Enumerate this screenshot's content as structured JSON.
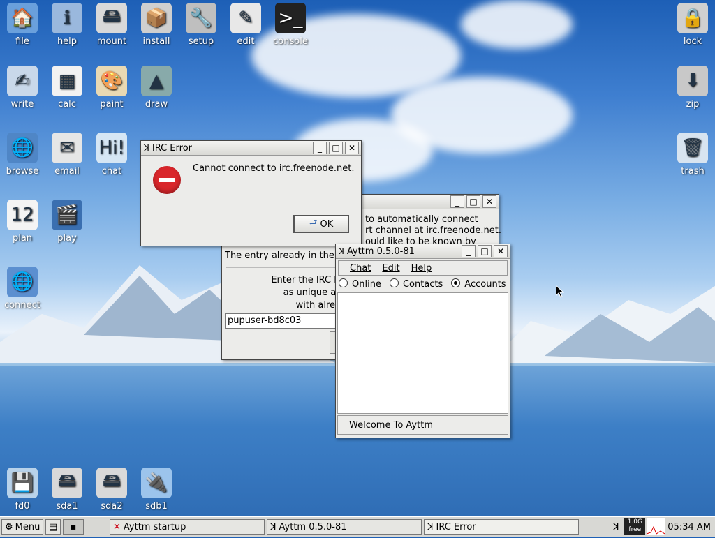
{
  "desktop_icons_left": [
    {
      "name": "file",
      "label": "file",
      "glyph": "🏠",
      "bg": "#6aa0dc"
    },
    {
      "name": "help",
      "label": "help",
      "glyph": "ℹ",
      "bg": "#9ab8dd"
    },
    {
      "name": "mount",
      "label": "mount",
      "glyph": "🖴",
      "bg": "#d9d9d9"
    },
    {
      "name": "install",
      "label": "install",
      "glyph": "📦",
      "bg": "#cfcfcf"
    },
    {
      "name": "setup",
      "label": "setup",
      "glyph": "🔧",
      "bg": "#bfbfbf"
    },
    {
      "name": "edit",
      "label": "edit",
      "glyph": "✎",
      "bg": "#e8e8e8"
    },
    {
      "name": "console",
      "label": "console",
      "glyph": ">_",
      "bg": "#222"
    },
    {
      "name": "write",
      "label": "write",
      "glyph": "✍",
      "bg": "#c9d8ea"
    },
    {
      "name": "calc",
      "label": "calc",
      "glyph": "▦",
      "bg": "#f2f2f2"
    },
    {
      "name": "paint",
      "label": "paint",
      "glyph": "🎨",
      "bg": "#e9d9b3"
    },
    {
      "name": "draw",
      "label": "draw",
      "glyph": "▲",
      "bg": "#8aa"
    },
    {
      "name": "browse",
      "label": "browse",
      "glyph": "🌐",
      "bg": "#4f86c6"
    },
    {
      "name": "email",
      "label": "email",
      "glyph": "✉",
      "bg": "#e6e6e6"
    },
    {
      "name": "chat",
      "label": "chat",
      "glyph": "Hi!",
      "bg": "#d6e6f4"
    },
    {
      "name": "plan",
      "label": "plan",
      "glyph": "12",
      "bg": "#f4f4f4"
    },
    {
      "name": "play",
      "label": "play",
      "glyph": "🎬",
      "bg": "#3a6fb0"
    },
    {
      "name": "connect",
      "label": "connect",
      "glyph": "🌐",
      "bg": "#5b8fd0"
    },
    {
      "name": "fd0",
      "label": "fd0",
      "glyph": "💾",
      "bg": "#b8d2ea"
    },
    {
      "name": "sda1",
      "label": "sda1",
      "glyph": "🖴",
      "bg": "#d9d9d9"
    },
    {
      "name": "sda2",
      "label": "sda2",
      "glyph": "🖴",
      "bg": "#d9d9d9"
    },
    {
      "name": "sdb1",
      "label": "sdb1",
      "glyph": "🔌",
      "bg": "#9cc4ec"
    }
  ],
  "desktop_icons_right": [
    {
      "name": "lock",
      "label": "lock",
      "glyph": "🔒",
      "bg": "#d0d0d0"
    },
    {
      "name": "zip",
      "label": "zip",
      "glyph": "⬇",
      "bg": "#c8c8c8"
    },
    {
      "name": "trash",
      "label": "trash",
      "glyph": "🗑",
      "bg": "#d8e4f0"
    }
  ],
  "irc_error": {
    "title": "IRC Error",
    "message": "Cannot connect to irc.freenode.net.",
    "ok_label": "OK"
  },
  "aytum_startup_partial": {
    "line1": "to automatically connect",
    "line2": "rt channel at irc.freenode.net.",
    "line3": "ould like to be known by",
    "entry_text": "The entry already in the",
    "prompt1": "Enter the IRC N",
    "prompt2": "as unique as",
    "prompt3": "with alrea",
    "nick_value": "pupuser-bd8c03"
  },
  "ayttm": {
    "title": "Ayttm 0.5.0-81",
    "menu": [
      "Chat",
      "Edit",
      "Help"
    ],
    "tabs": [
      {
        "label": "Online",
        "selected": false
      },
      {
        "label": "Contacts",
        "selected": false
      },
      {
        "label": "Accounts",
        "selected": true
      }
    ],
    "status": "Welcome To Ayttm"
  },
  "taskbar": {
    "menu_label": "Menu",
    "tasks": [
      "Ayttm startup",
      "Ayttm 0.5.0-81",
      "IRC Error"
    ],
    "free_label_top": "1.0G",
    "free_label_bottom": "free",
    "clock": "05:34 AM"
  },
  "colors": {
    "error_red": "#d9262b",
    "taskbar": "#d8d8d4"
  }
}
